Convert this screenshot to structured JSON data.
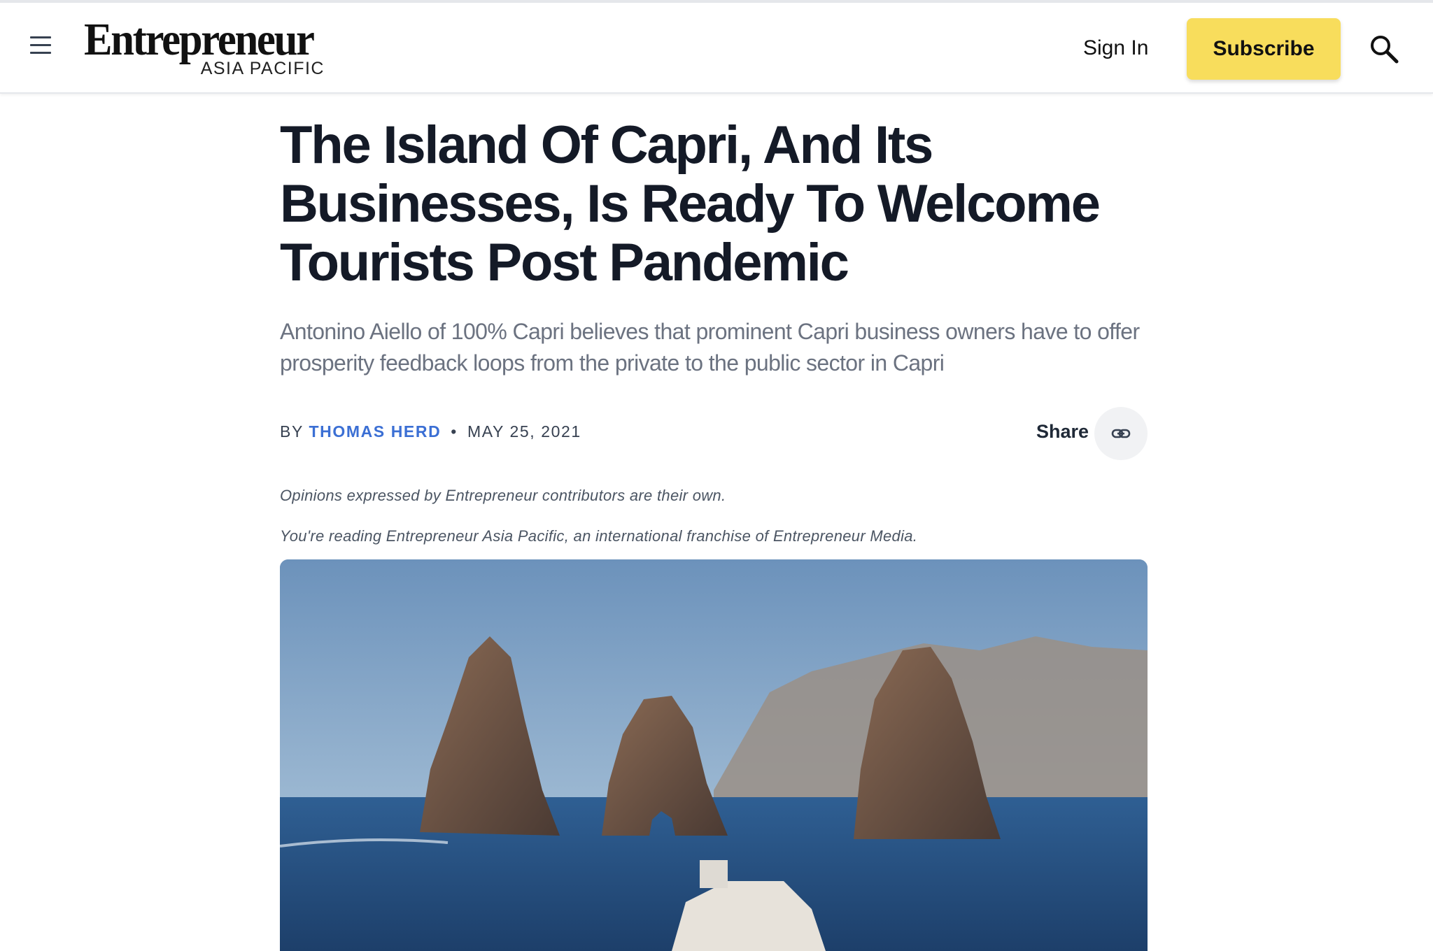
{
  "header": {
    "logo_main": "Entrepreneur",
    "logo_sub": "ASIA PACIFIC",
    "sign_in_label": "Sign In",
    "subscribe_label": "Subscribe"
  },
  "article": {
    "headline": "The Island Of Capri, And Its Businesses, Is Ready To Welcome Tourists Post Pandemic",
    "dek": "Antonino Aiello of 100% Capri believes that prominent Capri business owners have to offer prosperity feedback loops from the private to the public sector in Capri",
    "byline_prefix": "BY",
    "author": "THOMAS HERD",
    "separator": "•",
    "date": "MAY 25, 2021",
    "share_label": "Share",
    "disclaimer": "Opinions expressed by Entrepreneur contributors are their own.",
    "franchise_note": "You're reading Entrepreneur Asia Pacific, an international franchise of Entrepreneur Media."
  },
  "colors": {
    "subscribe_bg": "#f8dd5c",
    "author_link": "#3b6fd4",
    "headline": "#141a27",
    "dek": "#6b7280"
  },
  "icons": [
    "menu-icon",
    "search-icon",
    "link-icon"
  ]
}
